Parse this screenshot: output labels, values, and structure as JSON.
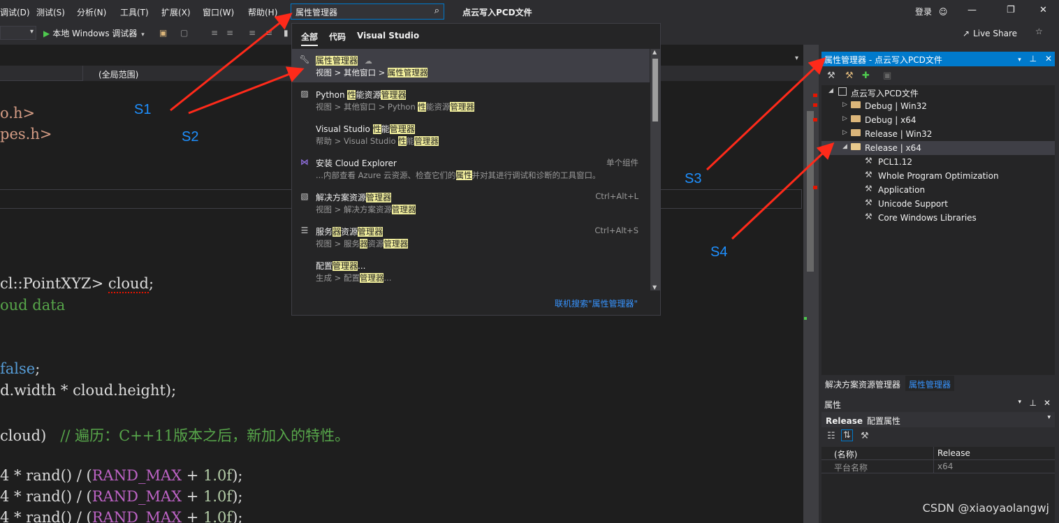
{
  "menubar": {
    "items": [
      "调试(D)",
      "测试(S)",
      "分析(N)",
      "工具(T)",
      "扩展(X)",
      "窗口(W)",
      "帮助(H)"
    ],
    "search_value": "属性管理器",
    "solution_title": "点云写入PCD文件",
    "login": "登录",
    "window_controls": [
      "—",
      "❐",
      "✕"
    ]
  },
  "toolbar": {
    "run_label": "本地 Windows 调试器",
    "live_share": "Live Share"
  },
  "editor": {
    "scope": "(全局范围)",
    "code": {
      "l1": "o.h>",
      "l2": "pes.h>",
      "l3a": "cl::PointXYZ> ",
      "l3b": "cloud",
      "l3c": ";",
      "l4": "oud data",
      "l5a": "false",
      "l5b": ";",
      "l6": "d.width * cloud.height);",
      "l7a": "cloud)   ",
      "l7b": "// 遍历：C++11版本之后，新加入的特性。",
      "l8a": "4 * rand() / (",
      "l8b": "RAND_MAX",
      "l8c": " + ",
      "l8d": "1.0f",
      "l8e": ");"
    }
  },
  "dropdown": {
    "tabs": [
      "全部",
      "代码",
      "Visual Studio"
    ],
    "items": [
      {
        "icon": "wrench-icon",
        "title_pre": "",
        "title_hl": "属性管理器",
        "title_post": "",
        "path_pre": "视图 > 其他窗口 > ",
        "path_hl": "属性管理器",
        "shortcut": ""
      },
      {
        "icon": "image-icon",
        "title_pre": "Python ",
        "title_hl": "性",
        "title_mid": "能资源",
        "title_hl2": "管理器",
        "path_pre": "视图 > 其他窗口 > Python ",
        "path_hl": "性",
        "path_mid": "能资源",
        "path_hl2": "管理器",
        "shortcut": ""
      },
      {
        "icon": "",
        "title_pre": "Visual Studio ",
        "title_hl": "性",
        "title_mid": "能",
        "title_hl2": "管理器",
        "path_pre": "帮助 > Visual Studio ",
        "path_hl": "性",
        "path_mid": "能",
        "path_hl2": "管理器",
        "shortcut": ""
      },
      {
        "icon": "vs-icon",
        "title": "安装 Cloud Explorer",
        "desc_pre": "...内部查看 Azure 云资源、检查它们的",
        "desc_hl": "属性",
        "desc_post": "并对其进行调试和诊断的工具窗口。",
        "shortcut": "单个组件"
      },
      {
        "icon": "solution-icon",
        "title_pre": "解决方案资源",
        "title_hl": "管理器",
        "path_pre": "视图 > 解决方案资源",
        "path_hl": "管理器",
        "shortcut": "Ctrl+Alt+L"
      },
      {
        "icon": "server-icon",
        "title_pre": "服务",
        "title_hl": "器",
        "title_mid": "资源",
        "title_hl2": "管理器",
        "path_pre": "视图 > 服务",
        "path_hl": "器",
        "path_mid": "资源",
        "path_hl2": "管理器",
        "shortcut": "Ctrl+Alt+S"
      },
      {
        "icon": "",
        "title_pre": "配置",
        "title_hl": "管理器",
        "title_post": "...",
        "path_pre": "生成 > 配置",
        "path_hl": "管理器",
        "path_post": "...",
        "shortcut": ""
      }
    ],
    "online_search": "联机搜索\"属性管理器\""
  },
  "property_manager": {
    "title": "属性管理器 - 点云写入PCD文件",
    "tree": {
      "root": "点云写入PCD文件",
      "configs": [
        "Debug | Win32",
        "Debug | x64",
        "Release | Win32",
        "Release | x64"
      ],
      "sheets": [
        "PCL1.12",
        "Whole Program Optimization",
        "Application",
        "Unicode Support",
        "Core Windows Libraries"
      ]
    },
    "tabs": [
      "解决方案资源管理器",
      "属性管理器"
    ]
  },
  "properties": {
    "title": "属性",
    "object_bold": "Release",
    "object_rest": "配置属性",
    "rows": [
      {
        "key": "(名称)",
        "value": "Release"
      },
      {
        "key": "平台名称",
        "value": "x64"
      }
    ]
  },
  "annotations": {
    "labels": [
      "S1",
      "S2",
      "S3",
      "S4"
    ],
    "color": "#ff2a1a",
    "label_color": "#1e90ff"
  },
  "watermark": "CSDN @xiaoyaolangwj",
  "colors": {
    "accent": "#007acc",
    "highlight": "#f3f09e",
    "background": "#1e1e1e"
  }
}
